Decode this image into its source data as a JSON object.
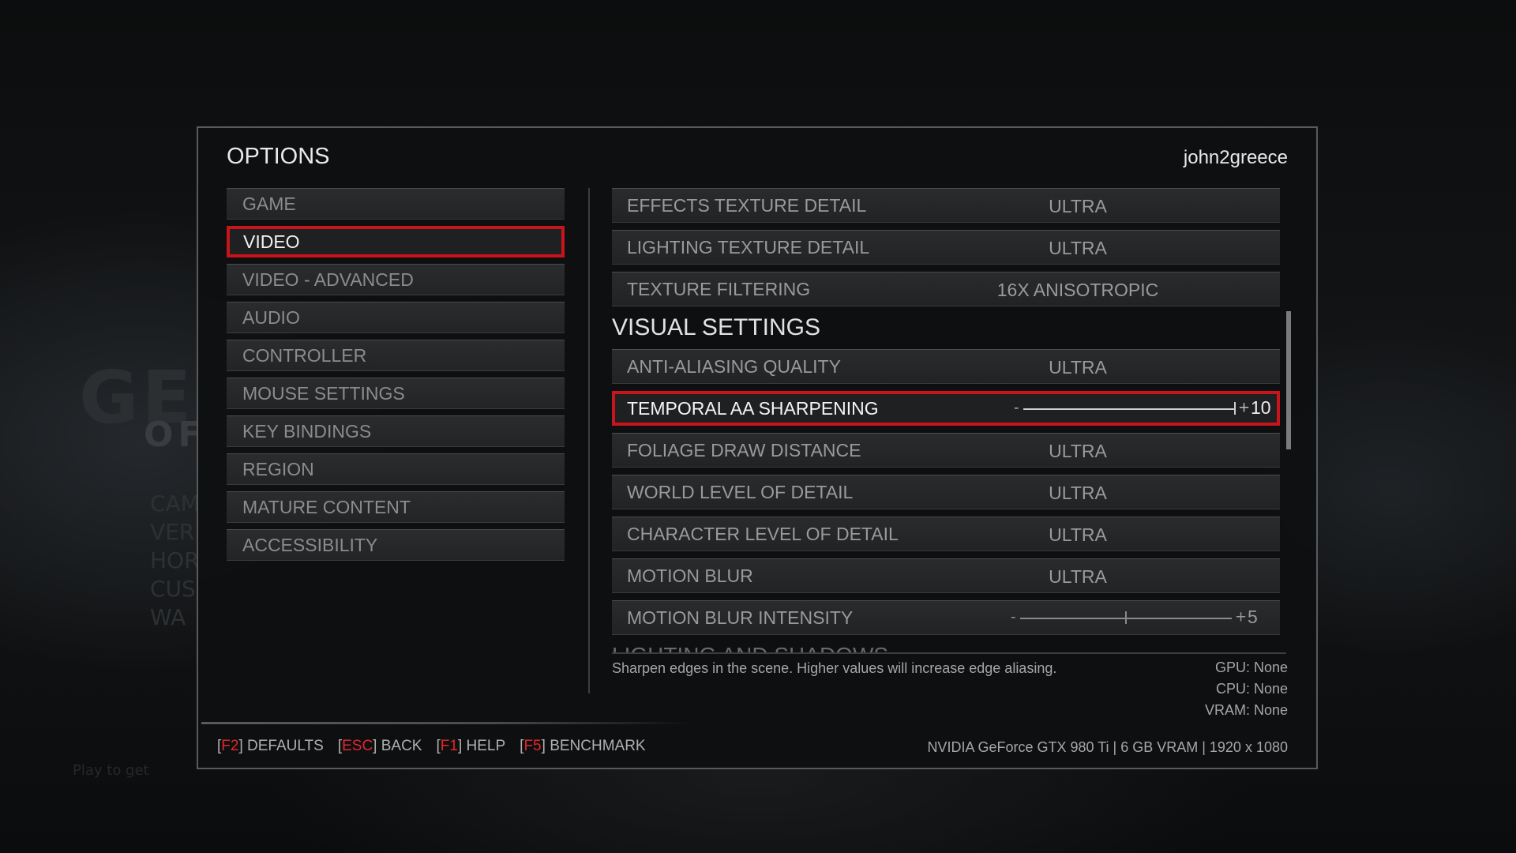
{
  "dialog": {
    "title": "OPTIONS",
    "user": "john2greece"
  },
  "categories": [
    {
      "label": "GAME",
      "active": false
    },
    {
      "label": "VIDEO",
      "active": true
    },
    {
      "label": "VIDEO - ADVANCED",
      "active": false
    },
    {
      "label": "AUDIO",
      "active": false
    },
    {
      "label": "CONTROLLER",
      "active": false
    },
    {
      "label": "MOUSE SETTINGS",
      "active": false
    },
    {
      "label": "KEY BINDINGS",
      "active": false
    },
    {
      "label": "REGION",
      "active": false
    },
    {
      "label": "MATURE CONTENT",
      "active": false
    },
    {
      "label": "ACCESSIBILITY",
      "active": false
    }
  ],
  "settings": {
    "top_rows": [
      {
        "label": "EFFECTS TEXTURE DETAIL",
        "value": "ULTRA"
      },
      {
        "label": "LIGHTING TEXTURE DETAIL",
        "value": "ULTRA"
      },
      {
        "label": "TEXTURE FILTERING",
        "value": "16X ANISOTROPIC"
      }
    ],
    "section_title": "VISUAL SETTINGS",
    "rows": [
      {
        "label": "ANTI-ALIASING QUALITY",
        "value": "ULTRA"
      },
      {
        "label": "TEMPORAL AA SHARPENING",
        "slider": {
          "minus": "-",
          "plus": "+",
          "value": "10",
          "fraction": 1.0
        }
      },
      {
        "label": "FOLIAGE DRAW DISTANCE",
        "value": "ULTRA"
      },
      {
        "label": "WORLD LEVEL OF DETAIL",
        "value": "ULTRA"
      },
      {
        "label": "CHARACTER LEVEL OF DETAIL",
        "value": "ULTRA"
      },
      {
        "label": "MOTION BLUR",
        "value": "ULTRA"
      },
      {
        "label": "MOTION BLUR INTENSITY",
        "slider": {
          "minus": "-",
          "plus": "+",
          "value": "5",
          "fraction": 0.5
        }
      }
    ],
    "next_section_peek": "LIGHTING AND SHADOWS"
  },
  "description": "Sharpen edges in the scene. Higher values will increase edge aliasing.",
  "hardware": {
    "gpu": "GPU: None",
    "cpu": "CPU: None",
    "vram": "VRAM: None"
  },
  "footer": {
    "keys": [
      {
        "key": "F2",
        "label": "DEFAULTS"
      },
      {
        "key": "ESC",
        "label": "BACK"
      },
      {
        "key": "F1",
        "label": "HELP"
      },
      {
        "key": "F5",
        "label": "BENCHMARK"
      }
    ],
    "gpu_info": "NVIDIA GeForce GTX 980 Ti | 6 GB VRAM | 1920 x 1080"
  },
  "colors": {
    "accent": "#c8141a",
    "key_red": "#e3262c",
    "panel_bg": "#0e0f10"
  }
}
